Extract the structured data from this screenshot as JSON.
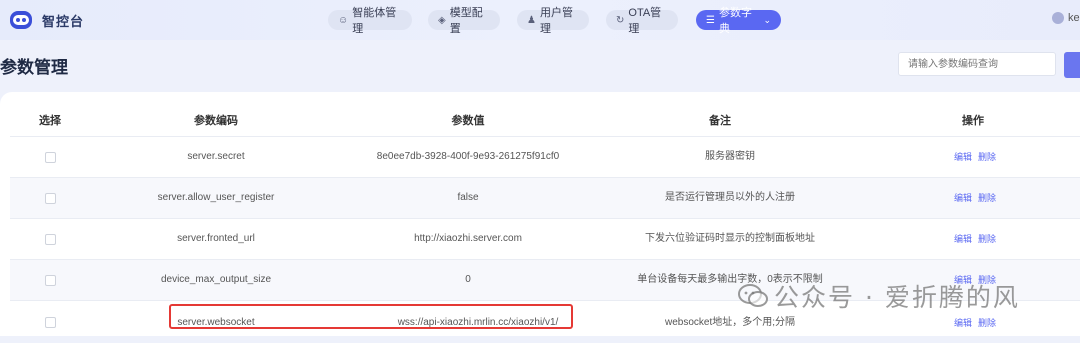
{
  "brand": {
    "name": "智控台"
  },
  "nav": {
    "items": [
      {
        "label": "智能体管理",
        "icon": "robot-icon"
      },
      {
        "label": "模型配置",
        "icon": "layers-icon"
      },
      {
        "label": "用户管理",
        "icon": "user-icon"
      },
      {
        "label": "OTA管理",
        "icon": "refresh-icon"
      },
      {
        "label": "参数字典",
        "icon": "dictionary-icon"
      }
    ],
    "active": "参数字典",
    "user": "ke"
  },
  "page": {
    "title": "参数管理",
    "search_placeholder": "请输入参数编码查询"
  },
  "table": {
    "headers": [
      "选择",
      "参数编码",
      "参数值",
      "备注",
      "操作"
    ],
    "rows": [
      {
        "code": "server.secret",
        "value": "8e0ee7db-3928-400f-9e93-261275f91cf0",
        "note": "服务器密钥"
      },
      {
        "code": "server.allow_user_register",
        "value": "false",
        "note": "是否运行管理员以外的人注册"
      },
      {
        "code": "server.fronted_url",
        "value": "http://xiaozhi.server.com",
        "note": "下发六位验证码时显示的控制面板地址"
      },
      {
        "code": "device_max_output_size",
        "value": "0",
        "note": "单台设备每天最多输出字数，0表示不限制"
      },
      {
        "code": "server.websocket",
        "value": "wss://api-xiaozhi.mrlin.cc/xiaozhi/v1/",
        "note": "websocket地址，多个用;分隔"
      }
    ],
    "actions": {
      "edit": "编辑",
      "delete": "删除"
    }
  },
  "watermark": {
    "text": "公众号 · 爱折腾的风"
  },
  "colors": {
    "accent": "#5a68f2",
    "highlight": "#e53935"
  }
}
